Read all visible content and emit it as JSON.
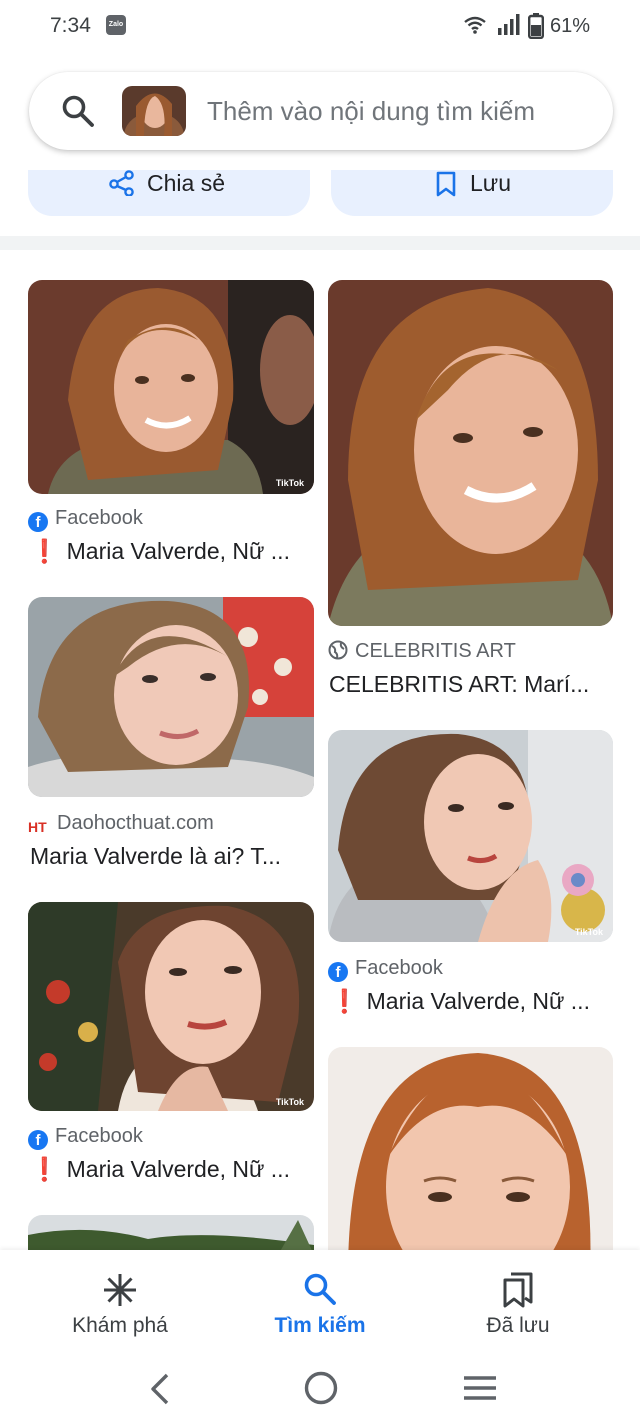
{
  "status_bar": {
    "time": "7:34",
    "notification_app": "Zalo",
    "battery_percent": "61%",
    "icons": [
      "zalo-icon",
      "wifi-icon",
      "signal-icon",
      "battery-icon"
    ]
  },
  "search": {
    "placeholder": "Thêm vào nội dung tìm kiếm",
    "value": ""
  },
  "actions": {
    "share_label": "Chia sẻ",
    "save_label": "Lưu"
  },
  "results": {
    "left": [
      {
        "source": "Facebook",
        "source_icon": "facebook-icon",
        "title": "Maria Valverde, Nữ ...",
        "has_alert": true,
        "watermark": "TikTok"
      },
      {
        "source": "Daohocthuat.com",
        "source_icon": "ht-icon",
        "source_icon_text": "HT",
        "title": "Maria Valverde là ai? T...",
        "has_alert": false
      },
      {
        "source": "Facebook",
        "source_icon": "facebook-icon",
        "title": "Maria Valverde, Nữ ...",
        "has_alert": true,
        "watermark": "TikTok"
      }
    ],
    "right": [
      {
        "source": "CELEBRITIS ART",
        "source_icon": "globe-icon",
        "title": "CELEBRITIS ART: Marí...",
        "has_alert": false
      },
      {
        "source": "Facebook",
        "source_icon": "facebook-icon",
        "title": "Maria Valverde, Nữ ...",
        "has_alert": true,
        "watermark": "TikTok"
      }
    ],
    "alert_mark": "❗"
  },
  "bottom_nav": {
    "items": [
      {
        "label": "Khám phá",
        "icon": "asterisk-icon",
        "active": false
      },
      {
        "label": "Tìm kiếm",
        "icon": "search-icon",
        "active": true
      },
      {
        "label": "Đã lưu",
        "icon": "bookmarks-icon",
        "active": false
      }
    ]
  },
  "system_nav": {
    "icons": [
      "back-icon",
      "home-icon",
      "recents-icon"
    ]
  },
  "colors": {
    "accent": "#1a73e8",
    "chip_background": "#e8f0fe",
    "alert": "#d93025",
    "facebook": "#1877f2"
  }
}
